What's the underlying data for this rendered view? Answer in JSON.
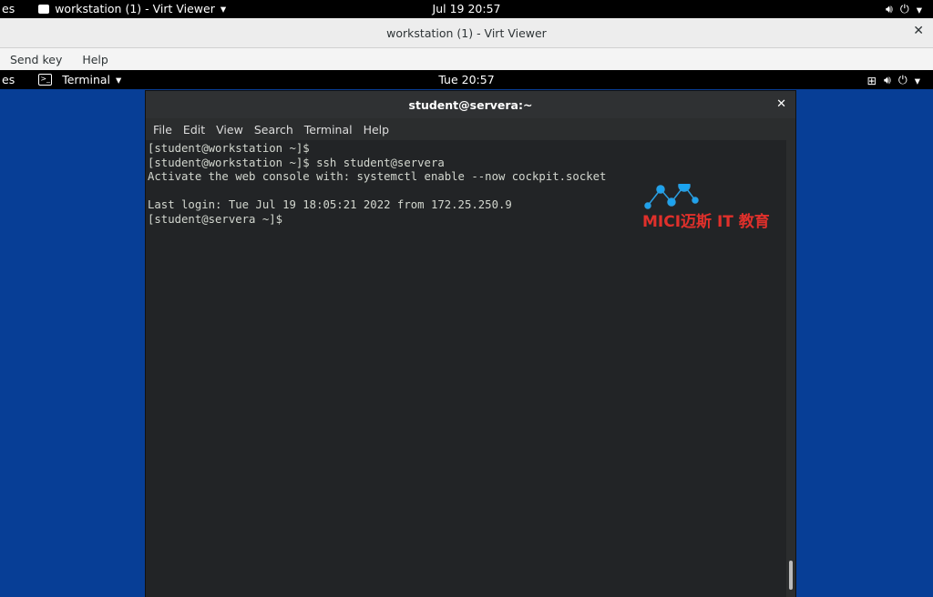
{
  "host_topbar": {
    "activities": "es",
    "app_name": "workstation (1) - Virt Viewer",
    "clock": "Jul 19  20:57"
  },
  "viewer_window": {
    "title": "workstation (1) - Virt Viewer",
    "menu": [
      "Send key",
      "Help"
    ]
  },
  "guest_topbar": {
    "activities": "es",
    "app_name": "Terminal",
    "clock": "Tue 20:57"
  },
  "terminal": {
    "title": "student@servera:~",
    "menu": [
      "File",
      "Edit",
      "View",
      "Search",
      "Terminal",
      "Help"
    ],
    "lines": [
      "[student@workstation ~]$",
      "[student@workstation ~]$ ssh student@servera",
      "Activate the web console with: systemctl enable --now cockpit.socket",
      "",
      "Last login: Tue Jul 19 18:05:21 2022 from 172.25.250.9",
      "[student@servera ~]$"
    ]
  },
  "watermark": {
    "text": "MICI迈斯 IT 教育"
  }
}
